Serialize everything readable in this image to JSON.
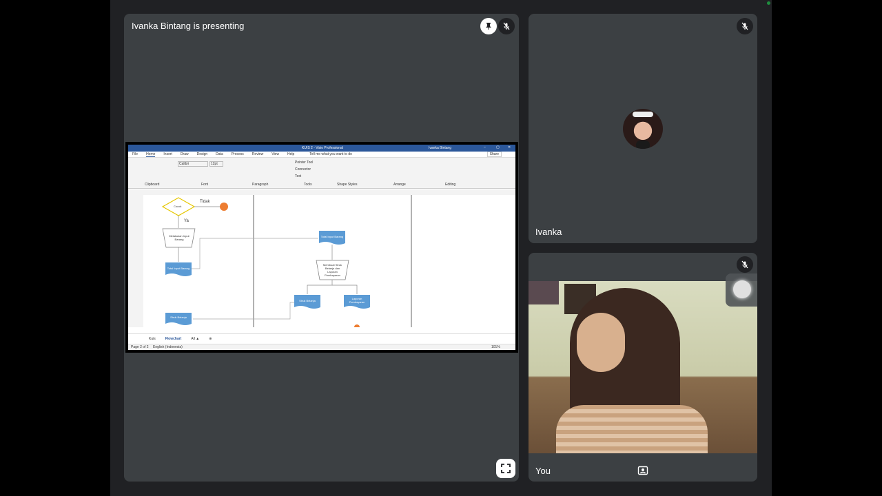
{
  "presenting_tile": {
    "label": "Ivanka Bintang is presenting",
    "pin_icon": "pin-icon",
    "mic_icon": "mic-off-icon",
    "fullscreen_icon": "fullscreen-icon"
  },
  "visio": {
    "window_title": "KUIS 2 - Visio Professional",
    "user_name": "Ivanka Bintang",
    "tabs": [
      "File",
      "Home",
      "Insert",
      "Draw",
      "Design",
      "Data",
      "Process",
      "Review",
      "View",
      "Help"
    ],
    "tell_me": "Tell me what you want to do",
    "share": "Share",
    "groups": [
      "Clipboard",
      "Font",
      "Paragraph",
      "Tools",
      "Shape Styles",
      "Arrange",
      "Editing"
    ],
    "font_name": "Calibri",
    "font_size": "12pt",
    "tools": [
      "Pointer Tool",
      "Connector",
      "Text"
    ],
    "shapes": {
      "decision": "Cocok",
      "no": "Tidak",
      "yes": "Ya",
      "manual_op_1": "Melakukan Input Barang",
      "doc_1": "Total Input Barang",
      "doc_2": "Total Input Barang",
      "doc_3": "Struk Belanja",
      "manual_op_2": "Membuat Struk Belanja dan Laporan Pembayaran",
      "doc_4": "Struk Belanja",
      "doc_5": "Laporan Pembayaran"
    },
    "sheets": [
      "Kuis",
      "Flowchart",
      "All ▲"
    ],
    "status_left": "Page 2 of 2",
    "status_lang": "English (Indonesia)",
    "zoom": "101%"
  },
  "tile_ivanka": {
    "label": "Ivanka",
    "mic_icon": "mic-off-icon"
  },
  "tile_you": {
    "label": "You",
    "mic_icon": "mic-off-icon",
    "effects_icon": "portrait-effects-icon"
  },
  "colors": {
    "stage_bg": "#202124",
    "tile_bg": "#3c4043",
    "visio_blue": "#2b579a",
    "shape_blue": "#5b9bd5",
    "orange": "#ed7d31"
  }
}
